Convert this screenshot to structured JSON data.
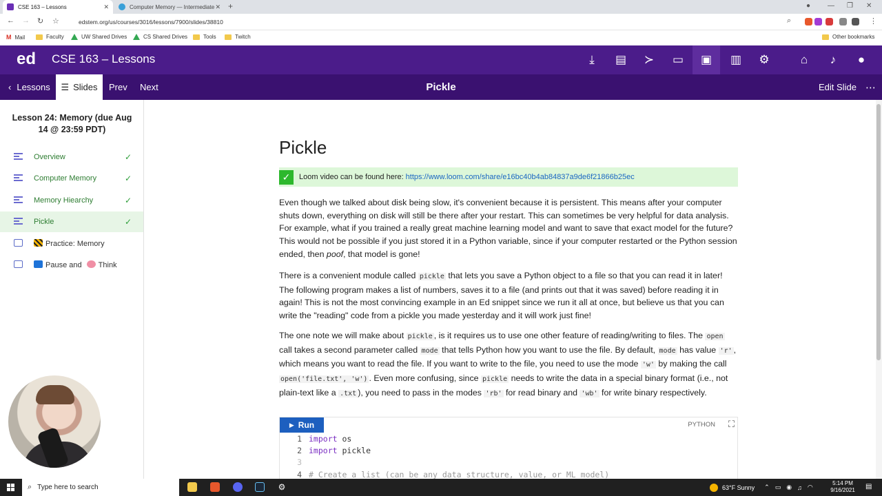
{
  "browser": {
    "tabs": [
      {
        "title": "CSE 163 – Lessons",
        "active": true
      },
      {
        "title": "Computer Memory — Intermediate D",
        "active": false
      }
    ],
    "url": "edstem.org/us/courses/3016/lessons/7900/slides/38810",
    "bookmarks": [
      "Mail",
      "Faculty",
      "UW Shared Drives",
      "CS Shared Drives",
      "Tools",
      "Twitch"
    ],
    "other_bookmarks": "Other bookmarks"
  },
  "header": {
    "logo": "ed",
    "course": "CSE 163 – Lessons"
  },
  "subheader": {
    "lessons": "Lessons",
    "slides": "Slides",
    "prev": "Prev",
    "next": "Next",
    "title": "Pickle",
    "edit": "Edit Slide"
  },
  "sidebar": {
    "lesson_title": "Lesson 24: Memory (due Aug 14 @ 23:59 PDT)",
    "items": [
      {
        "label": "Overview",
        "done": true
      },
      {
        "label": "Computer Memory",
        "done": true
      },
      {
        "label": "Memory Hiearchy",
        "done": true
      },
      {
        "label": "Pickle",
        "done": true
      },
      {
        "label": "Practice: Memory",
        "done": false
      },
      {
        "label": "Pause and",
        "label2": "Think",
        "done": false
      }
    ]
  },
  "content": {
    "heading": "Pickle",
    "loom_text": "Loom video can be found here:",
    "loom_link": "https://www.loom.com/share/e16bc40b4ab84837a9de6f21866b25ec",
    "p1": "Even though we talked about disk being slow, it's convenient because it is persistent. This means after your computer shuts down, everything on disk will still be there after your restart. This can sometimes be very helpful for data analysis. For example, what if you trained a really great machine learning model and want to save that exact model for the future? This would not be possible if you just stored it in a Python variable, since if your computer restarted or the Python session ended, then",
    "p1_em": "poof",
    "p1_end": ", that model is gone!",
    "p2_a": "There is a convenient module called",
    "p2_code": "pickle",
    "p2_b": "that lets you save a Python object to a file so that you can read it in later! The following program makes a list of numbers, saves it to a file (and prints out that it was saved) before reading it in again! This is not the most convincing example in an Ed snippet since we run it all at once, but believe us that you can write the \"reading\" code from a pickle you made yesterday and it will work just fine!",
    "p3": {
      "a": "The one note we will make about",
      "c1": "pickle",
      "b": ", is it requires us to use one other feature of reading/writing to files. The",
      "c2": "open",
      "c": "call takes a second parameter called",
      "c3": "mode",
      "d": "that tells Python how you want to use the file. By default,",
      "c4": "mode",
      "e": "has value",
      "c5": "'r'",
      "f": ", which means you want to read the file. If you want to write to the file, you need to use the mode",
      "c6": "'w'",
      "g": "by making the call",
      "c7": "open('file.txt', 'w')",
      "h": ". Even more confusing, since",
      "c8": "pickle",
      "i": "needs to write the data in a special binary format (i.e., not plain-text like a",
      "c9": ".txt",
      "j": "), you need to pass in the modes",
      "c10": "'rb'",
      "k": "for read binary and",
      "c11": "'wb'",
      "l": "for write binary respectively."
    },
    "code": {
      "run": "Run",
      "lang": "PYTHON",
      "lines": [
        {
          "n": "1",
          "kw": "import",
          "rest": " os"
        },
        {
          "n": "2",
          "kw": "import",
          "rest": " pickle"
        },
        {
          "n": "3",
          "kw": "",
          "rest": ""
        },
        {
          "n": "4",
          "kw": "",
          "rest": "# Create a list (can be any data structure, value, or ML model)"
        }
      ]
    }
  },
  "taskbar": {
    "search": "Type here to search",
    "weather": "63°F  Sunny",
    "time": "5:14 PM",
    "date": "9/16/2021"
  },
  "colors": {
    "ed_purple": "#4b1c8a",
    "ed_purple_dark": "#3a1170",
    "done_green": "#2e9e3a",
    "link_blue": "#1a66c2",
    "run_blue": "#1d5fbf"
  }
}
